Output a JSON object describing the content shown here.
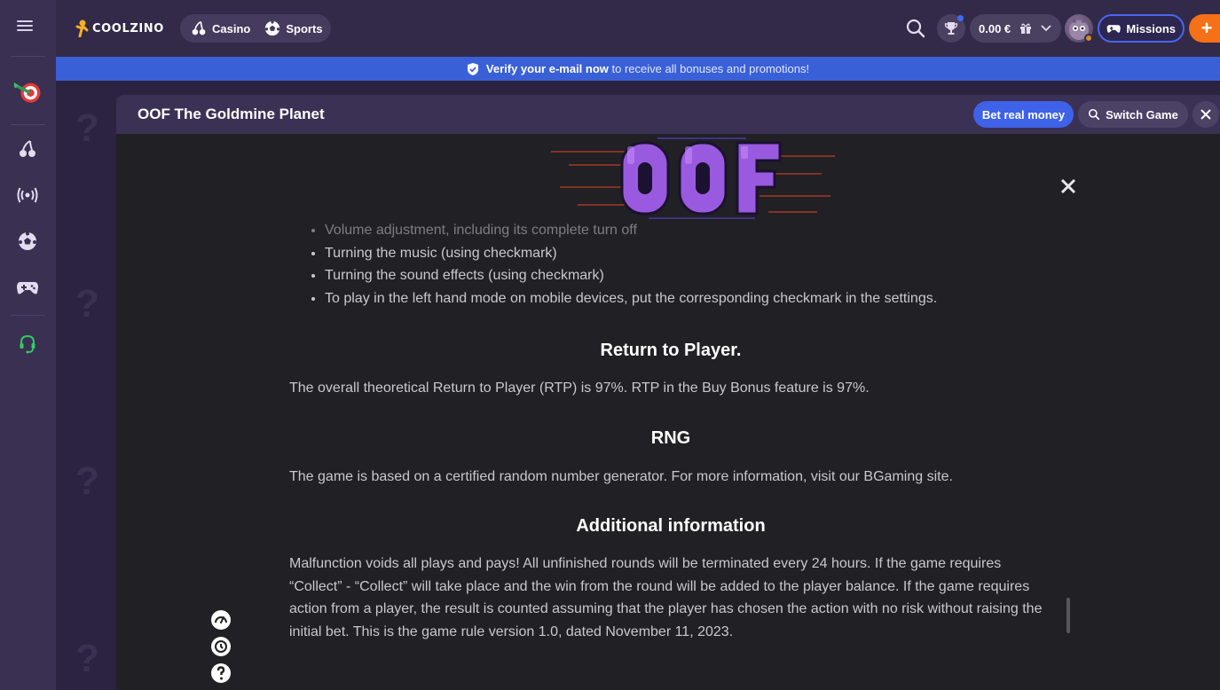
{
  "header": {
    "logo_text": "COOLZINO",
    "nav": [
      {
        "label": "Casino",
        "icon": "cherries-icon"
      },
      {
        "label": "Sports",
        "icon": "soccer-ball-icon"
      }
    ],
    "balance": "0.00 €",
    "missions_label": "Missions",
    "plus_label": "+"
  },
  "sidebar": {
    "items": [
      {
        "name": "dart-board-icon"
      },
      {
        "name": "cherries-icon"
      },
      {
        "name": "live-broadcast-icon"
      },
      {
        "name": "soccer-ball-icon"
      },
      {
        "name": "gamepad-icon"
      },
      {
        "name": "support-headset-icon"
      }
    ]
  },
  "banner": {
    "strong": "Verify your e-mail now",
    "rest": " to receive all bonuses and promotions!"
  },
  "game": {
    "title": "OOF The Goldmine Planet",
    "bet_label": "Bet real money",
    "switch_label": "Switch Game"
  },
  "rules": {
    "bullets": [
      "Volume adjustment, including its complete turn off",
      "Turning the music (using checkmark)",
      "Turning the sound effects (using checkmark)",
      "To play in the left hand mode on mobile devices, put the corresponding checkmark in the settings."
    ],
    "rtp_heading": "Return to Player.",
    "rtp_text": "The overall theoretical Return to Player (RTP) is 97%. RTP in the Buy Bonus feature is 97%.",
    "rng_heading": "RNG",
    "rng_text": "The game is based on a certified random number generator. For more information, visit our BGaming site.",
    "add_heading": "Additional information",
    "add_text": "Malfunction voids all plays and pays! All unfinished rounds will be terminated every 24 hours. If the game requires “Collect” - “Collect” will take place and the win from the round will be added to the player balance. If the game requires action from a player, the result is counted assuming that the player has chosen the action with no risk without raising the initial bet. This is the game rule version 1.0, dated November 11, 2023."
  },
  "colors": {
    "accent": "#3e62e8",
    "orange": "#f57016",
    "sidebar_bg": "#3a3052",
    "game_bg": "#212024"
  }
}
